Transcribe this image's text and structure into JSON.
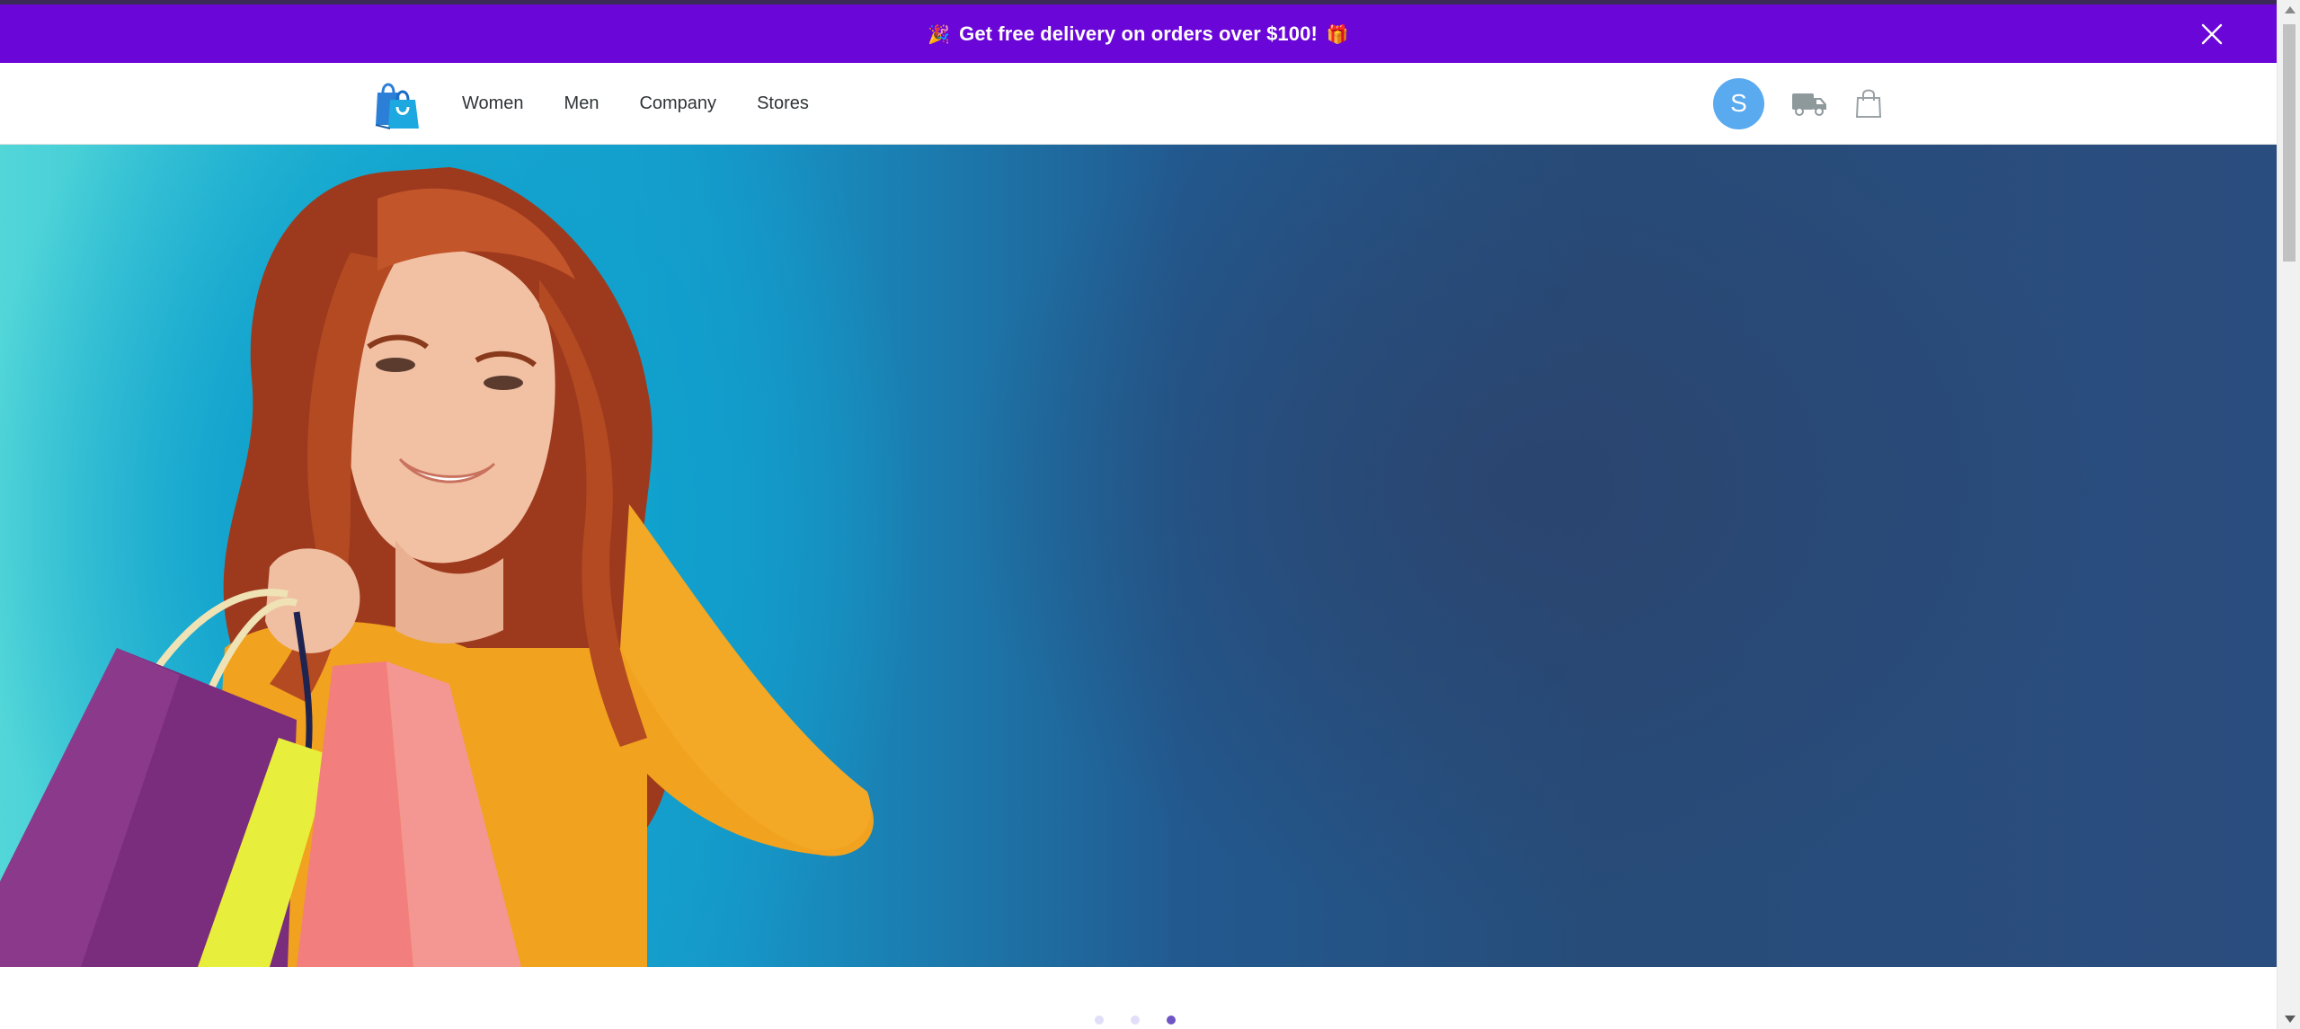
{
  "announcement": {
    "text": "Get free delivery on orders over $100!",
    "leading_emoji": "🎉",
    "trailing_emoji": "🎁",
    "close_icon": "close-icon",
    "background": "#6a06d8"
  },
  "header": {
    "logo_icon": "shopping-bags-logo-icon",
    "nav": [
      {
        "label": "Women"
      },
      {
        "label": "Men"
      },
      {
        "label": "Company"
      },
      {
        "label": "Stores"
      }
    ],
    "avatar_initial": "S",
    "avatar_color": "#5aaaef",
    "delivery_icon": "truck-icon",
    "cart_icon": "shopping-bag-icon"
  },
  "hero": {
    "image": "woman-holding-shopping-bags-photo",
    "colors": {
      "left": "#1cb3d3",
      "right": "#2a4d7f"
    }
  },
  "carousel": {
    "slides": 3,
    "active_index": 2,
    "active_color": "#6e55c3",
    "inactive_color": "#e1def8"
  }
}
